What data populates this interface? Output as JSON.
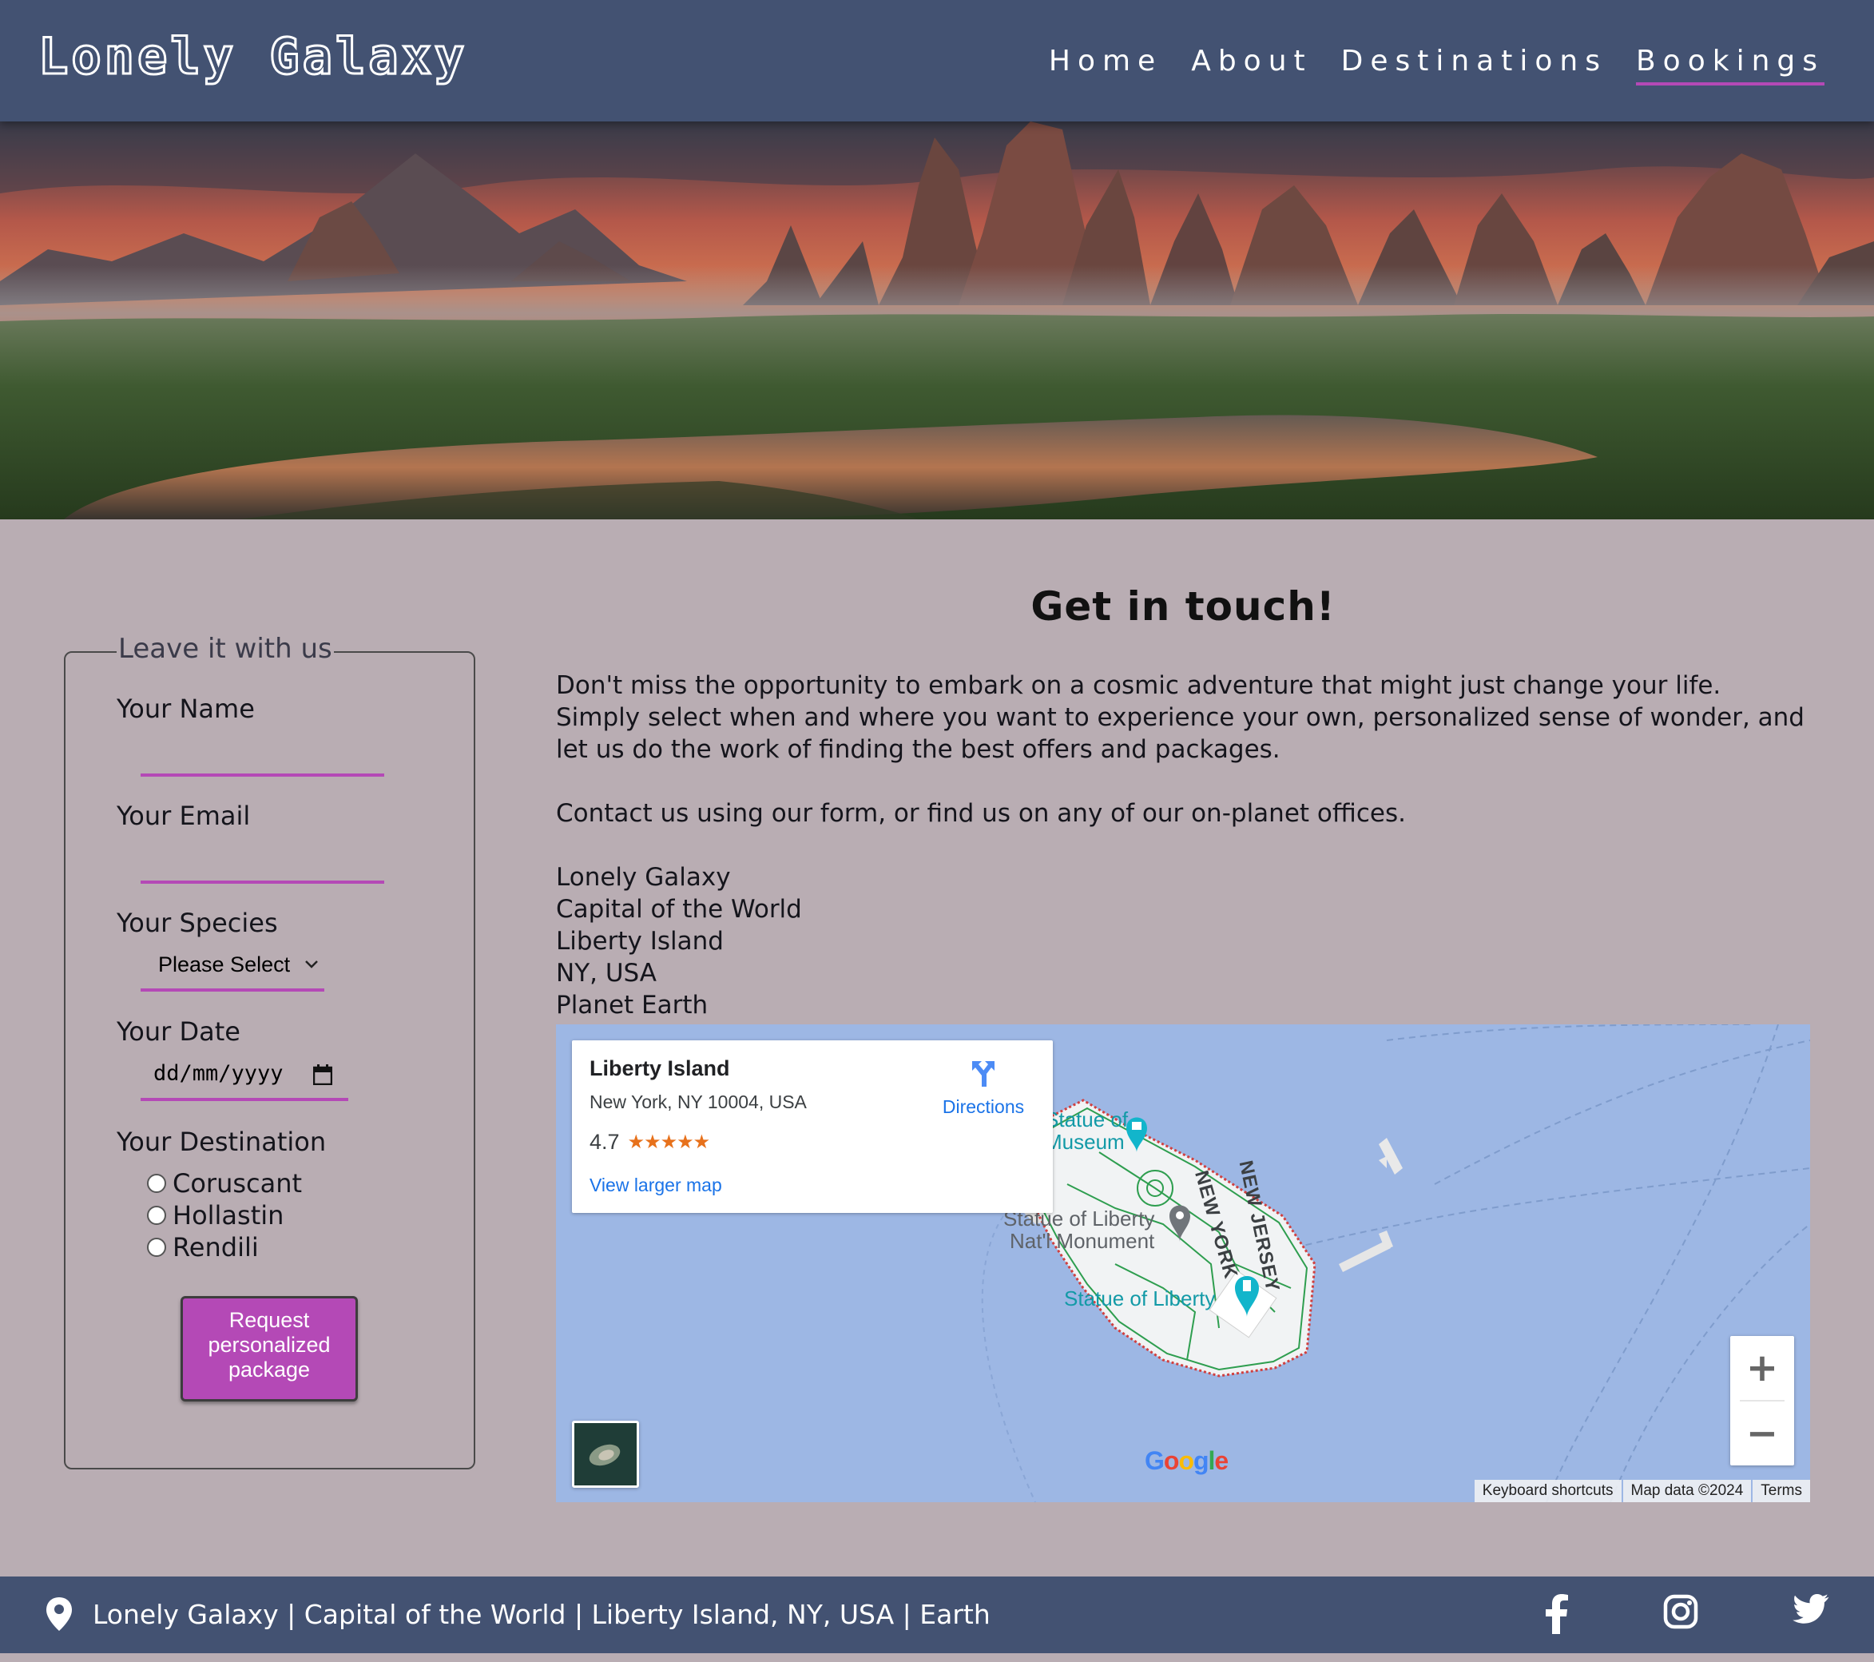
{
  "header": {
    "logo": "Lonely Galaxy",
    "nav": [
      "Home",
      "About",
      "Destinations",
      "Bookings"
    ],
    "active_nav": "Bookings"
  },
  "form": {
    "legend": "Leave it with us",
    "name_label": "Your Name",
    "name_value": "",
    "email_label": "Your Email",
    "email_value": "",
    "species_label": "Your Species",
    "species_selected": "Please Select",
    "date_label": "Your Date",
    "date_placeholder": "dd/mm/yyyy",
    "destination_label": "Your Destination",
    "destinations": [
      "Coruscant",
      "Hollastin",
      "Rendili"
    ],
    "submit_label": "Request personalized package"
  },
  "content": {
    "title": "Get in touch!",
    "paragraph1_line1": "Don't miss the opportunity to embark on a cosmic adventure that might just change your life.",
    "paragraph1_line2": "Simply select when and where you want to experience your own, personalized sense of wonder, and let us do the work of finding the best offers and packages.",
    "paragraph2": "Contact us using our form, or find us on any of our on-planet offices.",
    "address": [
      "Lonely Galaxy",
      "Capital of the World",
      "Liberty Island",
      "NY, USA",
      "Planet Earth"
    ]
  },
  "map": {
    "place_name": "Liberty Island",
    "place_address": "New York, NY 10004, USA",
    "rating": "4.7",
    "stars": "★★★★★",
    "directions_label": "Directions",
    "larger_map_link": "View larger map",
    "labels": {
      "museum_line1": "Statue of",
      "museum_line2": "Museum",
      "monument_line1": "Statue of Liberty",
      "monument_line2": "Nat'l Monument",
      "statue": "Statue of Liberty",
      "new_york": "NEW YORK",
      "new_jersey": "NEW JERSEY"
    },
    "zoom_in": "+",
    "zoom_out": "−",
    "google_logo": "Google",
    "attribution": [
      "Keyboard shortcuts",
      "Map data ©2024",
      "Terms"
    ]
  },
  "footer": {
    "text": "Lonely Galaxy | Capital of the World | Liberty Island, NY, USA | Earth",
    "social": [
      "facebook-icon",
      "instagram-icon",
      "twitter-icon"
    ]
  },
  "colors": {
    "header_bg": "#435272",
    "page_bg": "#b9adb3",
    "accent": "#b449b6",
    "map_water": "#9db7e4"
  }
}
